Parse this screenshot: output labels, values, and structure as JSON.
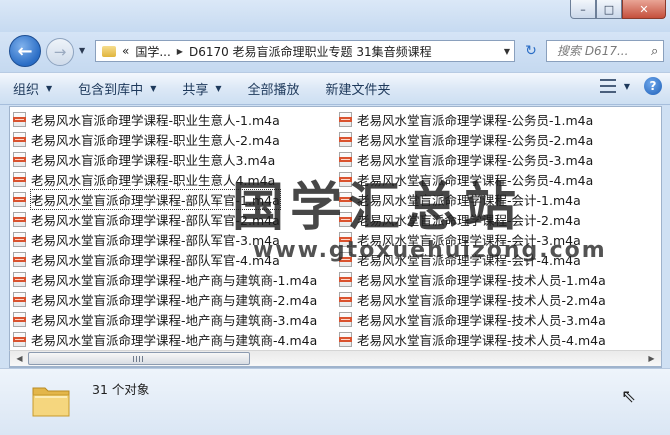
{
  "window": {
    "controls": {
      "minimize": "–",
      "maximize": "□",
      "close": "✕"
    }
  },
  "nav": {
    "back_glyph": "←",
    "forward_glyph": "→",
    "address": {
      "chevrons": "«",
      "seg1": "国学...",
      "seg2": "D6170 老易盲派命理职业专题 31集音频课程"
    },
    "search_placeholder": "搜索 D617..."
  },
  "toolbar": {
    "organize": "组织",
    "include_in_library": "包含到库中",
    "share": "共享",
    "play_all": "全部播放",
    "new_folder": "新建文件夹"
  },
  "files": {
    "column1": [
      "老易风水盲派命理学课程-职业生意人-1.m4a",
      "老易风水盲派命理学课程-职业生意人-2.m4a",
      "老易风水盲派命理学课程-职业生意人3.m4a",
      "老易风水盲派命理学课程-职业生意人4.m4a",
      "老易风水堂盲派命理学课程-部队军官-1.m4a",
      "老易风水堂盲派命理学课程-部队军官-2.m4a",
      "老易风水堂盲派命理学课程-部队军官-3.m4a",
      "老易风水堂盲派命理学课程-部队军官-4.m4a",
      "老易风水堂盲派命理学课程-地产商与建筑商-1.m4a",
      "老易风水堂盲派命理学课程-地产商与建筑商-2.m4a",
      "老易风水堂盲派命理学课程-地产商与建筑商-3.m4a",
      "老易风水堂盲派命理学课程-地产商与建筑商-4.m4a"
    ],
    "column2": [
      "老易风水堂盲派命理学课程-公务员-1.m4a",
      "老易风水堂盲派命理学课程-公务员-2.m4a",
      "老易风水堂盲派命理学课程-公务员-3.m4a",
      "老易风水堂盲派命理学课程-公务员-4.m4a",
      "老易风水堂盲派命理学课程-会计-1.m4a",
      "老易风水堂盲派命理学课程-会计-2.m4a",
      "老易风水堂盲派命理学课程-会计-3.m4a",
      "老易风水堂盲派命理学课程-会计-4.m4a",
      "老易风水堂盲派命理学课程-技术人员-1.m4a",
      "老易风水堂盲派命理学课程-技术人员-2.m4a",
      "老易风水堂盲派命理学课程-技术人员-3.m4a",
      "老易风水堂盲派命理学课程-技术人员-4.m4a"
    ],
    "selected_index": 4
  },
  "status": {
    "count_text": "31 个对象"
  },
  "watermark": {
    "title": "国学汇总站",
    "url": "www.gtoxuehuizong.com"
  },
  "colors": {
    "accent": "#2a6dc5",
    "file_icon": "#d9532f",
    "toolbar_text": "#1e395b"
  }
}
